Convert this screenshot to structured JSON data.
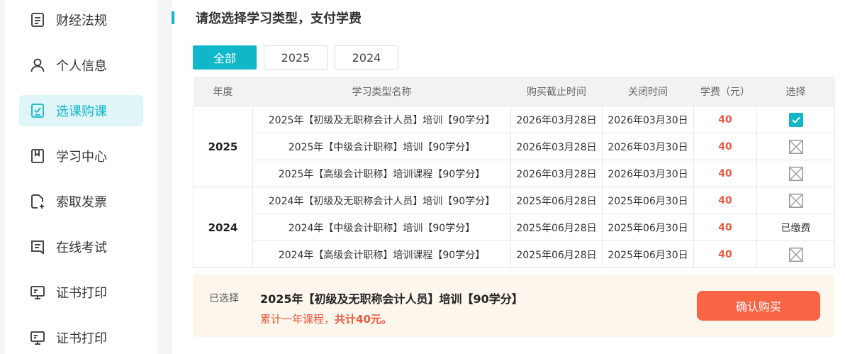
{
  "sidebar": {
    "items": [
      {
        "label": "财经法规",
        "icon": "document-icon",
        "active": false
      },
      {
        "label": "个人信息",
        "icon": "user-icon",
        "active": false
      },
      {
        "label": "选课购课",
        "icon": "checklist-icon",
        "active": true
      },
      {
        "label": "学习中心",
        "icon": "bookmark-icon",
        "active": false
      },
      {
        "label": "索取发票",
        "icon": "invoice-add-icon",
        "active": false
      },
      {
        "label": "在线考试",
        "icon": "exam-icon",
        "active": false
      },
      {
        "label": "证书打印",
        "icon": "monitor-icon",
        "active": false
      },
      {
        "label": "证书打印",
        "icon": "monitor-icon",
        "active": false
      }
    ]
  },
  "main": {
    "title": "请您选择学习类型，支付学费",
    "filters": [
      {
        "label": "全部",
        "active": true
      },
      {
        "label": "2025",
        "active": false
      },
      {
        "label": "2024",
        "active": false
      }
    ],
    "table": {
      "headers": [
        "年度",
        "学习类型名称",
        "购买截止时间",
        "关闭时间",
        "学费（元）",
        "选择"
      ],
      "groups": [
        {
          "year": "2025",
          "rows": [
            {
              "name": "2025年【初级及无职称会计人员】培训【90学分】",
              "deadline": "2026年03月28日",
              "close": "2026年03月30日",
              "fee": "40",
              "select": "checked"
            },
            {
              "name": "2025年【中级会计职称】培训【90学分】",
              "deadline": "2026年03月28日",
              "close": "2026年03月30日",
              "fee": "40",
              "select": "unchecked"
            },
            {
              "name": "2025年【高级会计职称】培训课程【90学分】",
              "deadline": "2026年03月28日",
              "close": "2026年03月30日",
              "fee": "40",
              "select": "unchecked"
            }
          ]
        },
        {
          "year": "2024",
          "rows": [
            {
              "name": "2024年【初级及无职称会计人员】培训【90学分】",
              "deadline": "2025年06月28日",
              "close": "2025年06月30日",
              "fee": "40",
              "select": "unchecked"
            },
            {
              "name": "2024年【中级会计职称】培训【90学分】",
              "deadline": "2025年06月28日",
              "close": "2025年06月30日",
              "fee": "40",
              "select": "paid",
              "select_text": "已缴费"
            },
            {
              "name": "2024年【高级会计职称】培训课程【90学分】",
              "deadline": "2025年06月28日",
              "close": "2025年06月30日",
              "fee": "40",
              "select": "unchecked"
            }
          ]
        }
      ]
    },
    "summary": {
      "label": "已选择",
      "course": "2025年【初级及无职称会计人员】培训【90学分】",
      "total_prefix": "累计一年课程，",
      "total_amount": "共计40元。",
      "confirm_label": "确认购买"
    }
  },
  "colors": {
    "accent": "#10b7c9",
    "fee": "#e95a3f",
    "confirm": "#f96444",
    "summary_bg": "#fdf6ec"
  }
}
